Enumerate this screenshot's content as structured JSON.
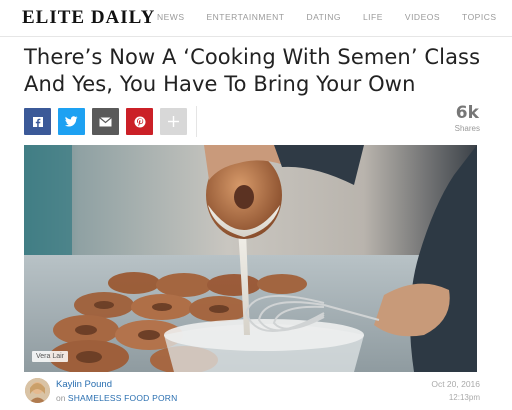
{
  "site": {
    "logo": "ELITE DAILY",
    "nav": [
      "NEWS",
      "ENTERTAINMENT",
      "DATING",
      "LIFE",
      "VIDEOS",
      "TOPICS"
    ]
  },
  "article": {
    "headline": "There’s Now A ‘Cooking With Semen’ Class And Yes, You Have To Bring Your Own",
    "image_credit": "Vera Lair",
    "author": "Kaylin Pound",
    "channel_prefix": "on",
    "channel": "SHAMELESS FOOD PORN",
    "date": "Oct 20, 2016",
    "time": "12:13pm"
  },
  "share": {
    "count": "6k",
    "count_label": "Shares",
    "buttons": [
      {
        "name": "facebook",
        "icon": "facebook-icon",
        "color": "#3b5998"
      },
      {
        "name": "twitter",
        "icon": "twitter-icon",
        "color": "#1da1f2"
      },
      {
        "name": "email",
        "icon": "email-icon",
        "color": "#5a5a5a"
      },
      {
        "name": "pinterest",
        "icon": "pinterest-icon",
        "color": "#cb2027"
      },
      {
        "name": "more",
        "icon": "plus-icon",
        "color": "#d8d8d8"
      }
    ]
  }
}
